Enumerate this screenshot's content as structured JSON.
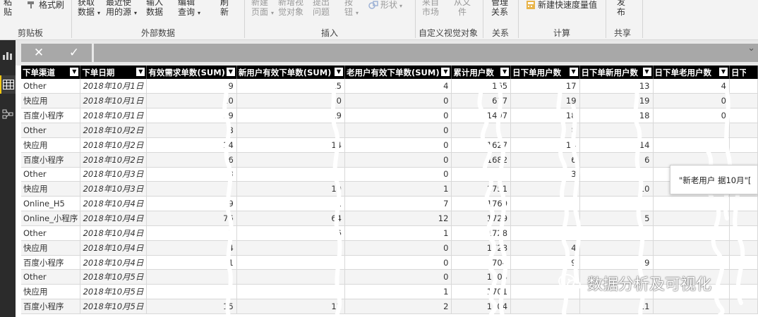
{
  "ribbon": {
    "clipboard": {
      "paste": "粘\n贴",
      "format_painter": "格式刷",
      "label": "剪贴板"
    },
    "external": {
      "get_data": "获取\n数据",
      "recent_sources": "最近使\n用的源",
      "enter_data": "输入\n数据",
      "edit_queries": "编辑\n查询",
      "refresh": "刷\n新",
      "label": "外部数据"
    },
    "insert": {
      "new_page": "新建\n页面",
      "new_visual": "新增视\n觉对象",
      "ask_question": "提出\n问题",
      "buttons": "按\n钮",
      "shapes": "形状",
      "label": "插入"
    },
    "custom_visuals": {
      "from_marketplace": "来自\n市场",
      "from_file": "从文\n件",
      "label": "自定义视觉对象"
    },
    "relationships": {
      "manage": "管理\n关系",
      "label": "关系"
    },
    "calculations": {
      "quick_measure": "新建快速度量值",
      "label": "计算"
    },
    "share": {
      "publish": "发\n布",
      "label": "共享"
    }
  },
  "formula_bar": {
    "cancel": "✕",
    "commit": "✓"
  },
  "table": {
    "columns": [
      "下单渠道",
      "下单日期",
      "有效需求单数(SUM)",
      "新用户有效下单数(SUM)",
      "老用户有效下单数(SUM)",
      "累计用户数",
      "日下单用户数",
      "日下单新用户数",
      "日下单老用户数",
      "日下单"
    ],
    "rows": [
      [
        "Other",
        "2018年10月1日",
        "19",
        "15",
        "4",
        "165",
        "17",
        "13",
        "4",
        ""
      ],
      [
        "快应用",
        "2018年10月1日",
        "20",
        "20",
        "0",
        "617",
        "19",
        "19",
        "0",
        ""
      ],
      [
        "百度小程序",
        "2018年10月1日",
        "19",
        "19",
        "0",
        "1497",
        "18",
        "18",
        "0",
        ""
      ],
      [
        "Other",
        "2018年10月2日",
        "8",
        "",
        "0",
        "",
        "8",
        "",
        "",
        ""
      ],
      [
        "快应用",
        "2018年10月2日",
        "14",
        "14",
        "0",
        "1627",
        "14",
        "14",
        "",
        ""
      ],
      [
        "百度小程序",
        "2018年10月2日",
        "6",
        "",
        "0",
        "1682",
        "6",
        "6",
        "",
        ""
      ],
      [
        "Other",
        "2018年10月3日",
        "3",
        "",
        "0",
        "",
        "3",
        "",
        "",
        ""
      ],
      [
        "快应用",
        "2018年10月3日",
        "",
        "10",
        "1",
        "1751",
        "",
        "10",
        "",
        ""
      ],
      [
        "Online_H5",
        "2018年10月4日",
        "9",
        "1",
        "7",
        "1769",
        "",
        "",
        "",
        ""
      ],
      [
        "Online_小程序",
        "2018年10月4日",
        "76",
        "64",
        "12",
        "1729",
        "",
        "5",
        "",
        ""
      ],
      [
        "Other",
        "2018年10月4日",
        "7",
        "6",
        "1",
        "1728",
        "",
        "",
        "",
        ""
      ],
      [
        "快应用",
        "2018年10月4日",
        "4",
        "",
        "0",
        "1728",
        "4",
        "",
        "",
        ""
      ],
      [
        "百度小程序",
        "2018年10月4日",
        "1",
        "",
        "0",
        "1704",
        "9",
        "9",
        "",
        ""
      ],
      [
        "Other",
        "2018年10月5日",
        "",
        "",
        "0",
        "1703",
        "",
        "",
        "",
        ""
      ],
      [
        "快应用",
        "2018年10月5日",
        "",
        "",
        "1",
        "1701",
        "",
        "",
        "",
        ""
      ],
      [
        "百度小程序",
        "2018年10月5日",
        "15",
        "13",
        "2",
        "1704",
        "",
        "11",
        "",
        ""
      ]
    ]
  },
  "tooltip": {
    "text": "\"新老用户   据10月\"["
  },
  "watermark": {
    "text": "数据分析及可视化"
  }
}
